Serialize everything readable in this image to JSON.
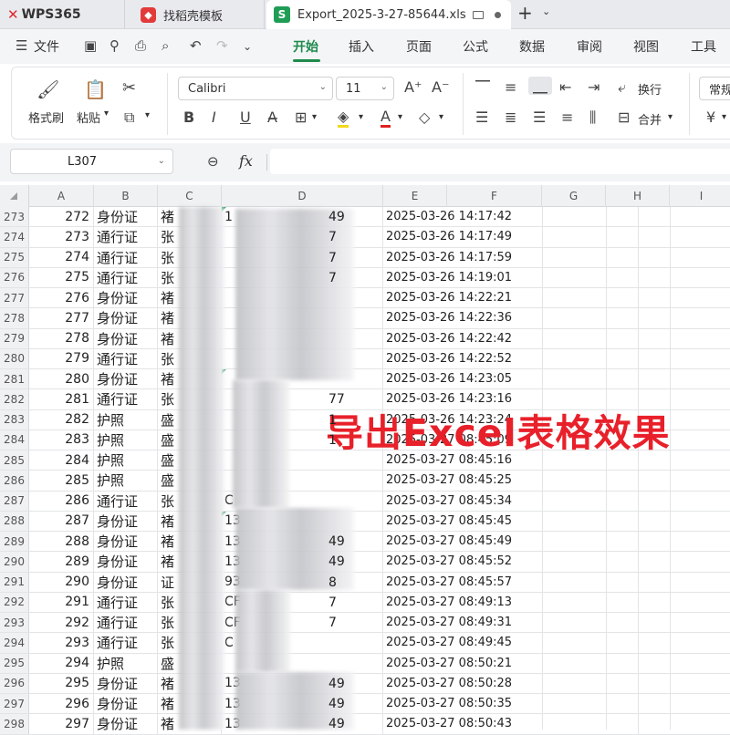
{
  "tabs": {
    "wps_label": "WPS365",
    "template_label": "找稻壳模板",
    "file_label": "Export_2025-3-27-85644.xls"
  },
  "menu": {
    "file_label": "文件",
    "items": [
      "开始",
      "插入",
      "页面",
      "公式",
      "数据",
      "审阅",
      "视图",
      "工具"
    ],
    "active": "开始"
  },
  "ribbon": {
    "format_painter": "格式刷",
    "paste": "粘贴",
    "font_name": "Calibri",
    "font_size": "11",
    "wrap_text": "换行",
    "merge": "合并",
    "number_format": "常规",
    "bold": "B",
    "italic": "I",
    "underline": "U"
  },
  "formula_bar": {
    "cell_ref": "L307",
    "fx": "fx"
  },
  "columns": [
    "A",
    "B",
    "C",
    "D",
    "E",
    "F",
    "G",
    "H",
    "I"
  ],
  "rows": [
    {
      "row": "273",
      "a": "272",
      "b": "身份证",
      "c": "褚",
      "d": "1",
      "d2": "49",
      "e": "2025-03-26 14:17:42"
    },
    {
      "row": "274",
      "a": "273",
      "b": "通行证",
      "c": "张",
      "d": "",
      "d2": "7",
      "e": "2025-03-26 14:17:49"
    },
    {
      "row": "275",
      "a": "274",
      "b": "通行证",
      "c": "张",
      "d": "",
      "d2": "7",
      "e": "2025-03-26 14:17:59"
    },
    {
      "row": "276",
      "a": "275",
      "b": "通行证",
      "c": "张",
      "d": "",
      "d2": "7",
      "e": "2025-03-26 14:19:01"
    },
    {
      "row": "277",
      "a": "276",
      "b": "身份证",
      "c": "褚",
      "d": "",
      "d2": "",
      "e": "2025-03-26 14:22:21"
    },
    {
      "row": "278",
      "a": "277",
      "b": "身份证",
      "c": "褚",
      "d": "",
      "d2": "",
      "e": "2025-03-26 14:22:36"
    },
    {
      "row": "279",
      "a": "278",
      "b": "身份证",
      "c": "褚",
      "d": "",
      "d2": "",
      "e": "2025-03-26 14:22:42"
    },
    {
      "row": "280",
      "a": "279",
      "b": "通行证",
      "c": "张",
      "d": "",
      "d2": "",
      "e": "2025-03-26 14:22:52"
    },
    {
      "row": "281",
      "a": "280",
      "b": "身份证",
      "c": "褚",
      "d": "",
      "d2": "",
      "e": "2025-03-26 14:23:05"
    },
    {
      "row": "282",
      "a": "281",
      "b": "通行证",
      "c": "张",
      "d": "",
      "d2": "77",
      "e": "2025-03-26 14:23:16"
    },
    {
      "row": "283",
      "a": "282",
      "b": "护照",
      "c": "盛",
      "d": "",
      "d2": "1",
      "e": "2025-03-26 14:23:24"
    },
    {
      "row": "284",
      "a": "283",
      "b": "护照",
      "c": "盛",
      "d": "",
      "d2": "1",
      "e": "2025-03-27 08:45:09"
    },
    {
      "row": "285",
      "a": "284",
      "b": "护照",
      "c": "盛",
      "d": "",
      "d2": "",
      "e": "2025-03-27 08:45:16"
    },
    {
      "row": "286",
      "a": "285",
      "b": "护照",
      "c": "盛",
      "d": "",
      "d2": "",
      "e": "2025-03-27 08:45:25"
    },
    {
      "row": "287",
      "a": "286",
      "b": "通行证",
      "c": "张",
      "d": "C",
      "d2": "",
      "e": "2025-03-27 08:45:34"
    },
    {
      "row": "288",
      "a": "287",
      "b": "身份证",
      "c": "褚",
      "d": "13",
      "d2": "",
      "e": "2025-03-27 08:45:45"
    },
    {
      "row": "289",
      "a": "288",
      "b": "身份证",
      "c": "褚",
      "d": "13",
      "d2": "49",
      "e": "2025-03-27 08:45:49"
    },
    {
      "row": "290",
      "a": "289",
      "b": "身份证",
      "c": "褚",
      "d": "13",
      "d2": "49",
      "e": "2025-03-27 08:45:52"
    },
    {
      "row": "291",
      "a": "290",
      "b": "身份证",
      "c": "证",
      "d": "93",
      "d2": "8",
      "e": "2025-03-27 08:45:57"
    },
    {
      "row": "292",
      "a": "291",
      "b": "通行证",
      "c": "张",
      "d": "CF",
      "d2": "7",
      "e": "2025-03-27 08:49:13"
    },
    {
      "row": "293",
      "a": "292",
      "b": "通行证",
      "c": "张",
      "d": "CF",
      "d2": "7",
      "e": "2025-03-27 08:49:31"
    },
    {
      "row": "294",
      "a": "293",
      "b": "通行证",
      "c": "张",
      "d": "C",
      "d2": "",
      "e": "2025-03-27 08:49:45"
    },
    {
      "row": "295",
      "a": "294",
      "b": "护照",
      "c": "盛",
      "d": "",
      "d2": "",
      "e": "2025-03-27 08:50:21"
    },
    {
      "row": "296",
      "a": "295",
      "b": "身份证",
      "c": "褚",
      "d": "13",
      "d2": "49",
      "e": "2025-03-27 08:50:28"
    },
    {
      "row": "297",
      "a": "296",
      "b": "身份证",
      "c": "褚",
      "d": "13",
      "d2": "49",
      "e": "2025-03-27 08:50:35"
    },
    {
      "row": "298",
      "a": "297",
      "b": "身份证",
      "c": "褚",
      "d": "13",
      "d2": "49",
      "e": "2025-03-27 08:50:43"
    }
  ],
  "annotation": "导出Excel表格效果",
  "colors": {
    "accent": "#1f8a4c",
    "annotation": "#e8202a",
    "wps_brand": "#e0262b"
  }
}
